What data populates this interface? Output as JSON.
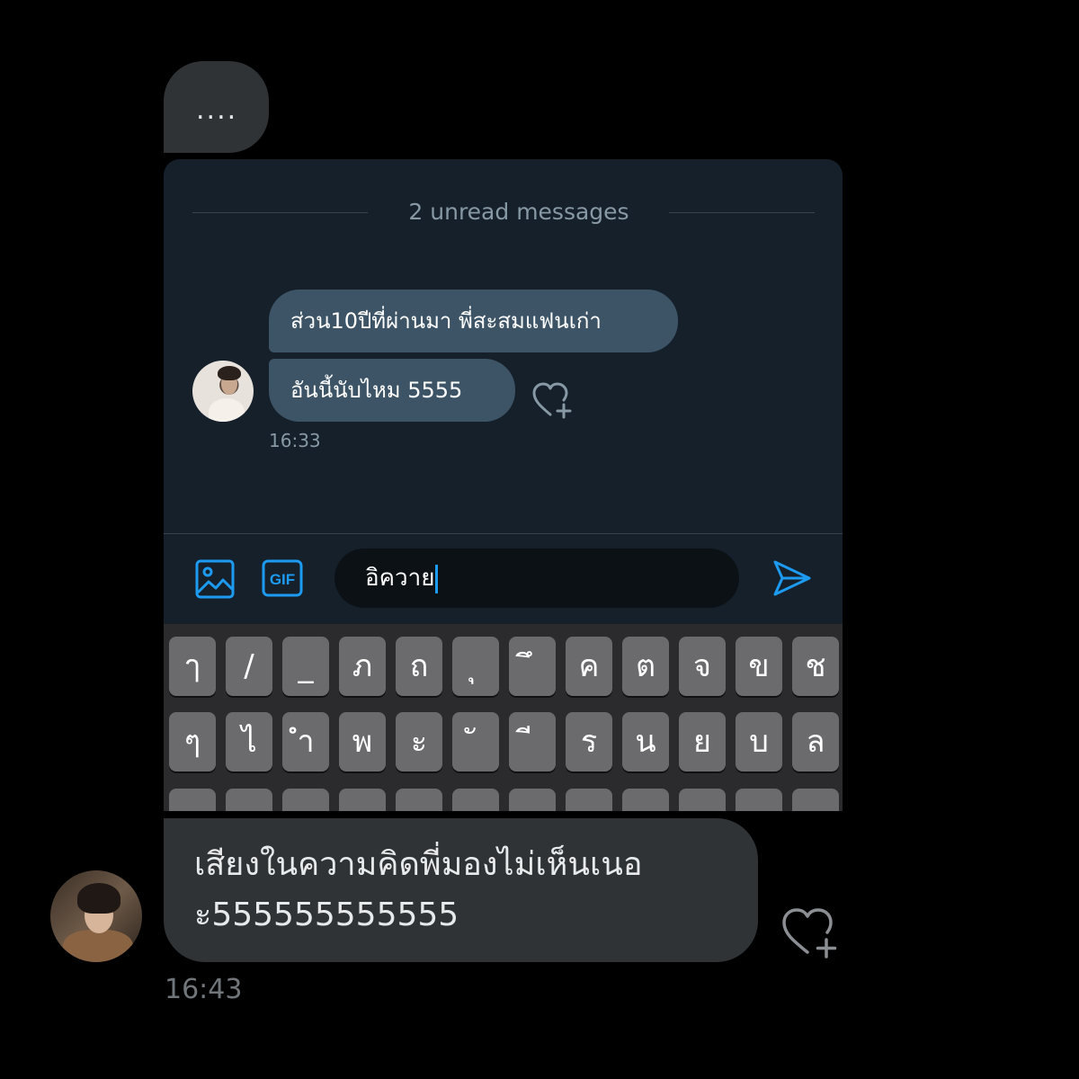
{
  "typing_indicator": {
    "text": "...."
  },
  "inner_screenshot": {
    "unread_divider": "2 unread messages",
    "messages": [
      {
        "text": "ส่วน10ปีที่ผ่านมา พี่สะสมแฟนเก่า"
      },
      {
        "text": "อันนี้นับไหม 5555"
      }
    ],
    "timestamp": "16:33",
    "composer": {
      "gif_label": "GIF",
      "input_value": "อิควาย"
    },
    "keyboard": {
      "row1": [
        "ๅ",
        "/",
        "_",
        "ภ",
        "ถ",
        "ุ",
        "ึ",
        "ค",
        "ต",
        "จ",
        "ข",
        "ช"
      ],
      "row2": [
        "ๆ",
        "ไ",
        "ำ",
        "พ",
        "ะ",
        "ั",
        "ี",
        "ร",
        "น",
        "ย",
        "บ",
        "ล"
      ],
      "row3": [
        "",
        "",
        "",
        "",
        "",
        "",
        "",
        "",
        "",
        "",
        "",
        ""
      ]
    },
    "colors": {
      "accent": "#1d9bf0",
      "background": "#15202b",
      "bubble": "#3d5466"
    }
  },
  "reply": {
    "lines": [
      "เสียงในความคิดพี่มองไม่เห็นเนอ",
      "ะ555555555555"
    ],
    "timestamp": "16:43"
  },
  "icons": {
    "like": "heart-plus-icon",
    "media": "image-icon",
    "gif": "gif-icon",
    "send": "send-icon"
  }
}
